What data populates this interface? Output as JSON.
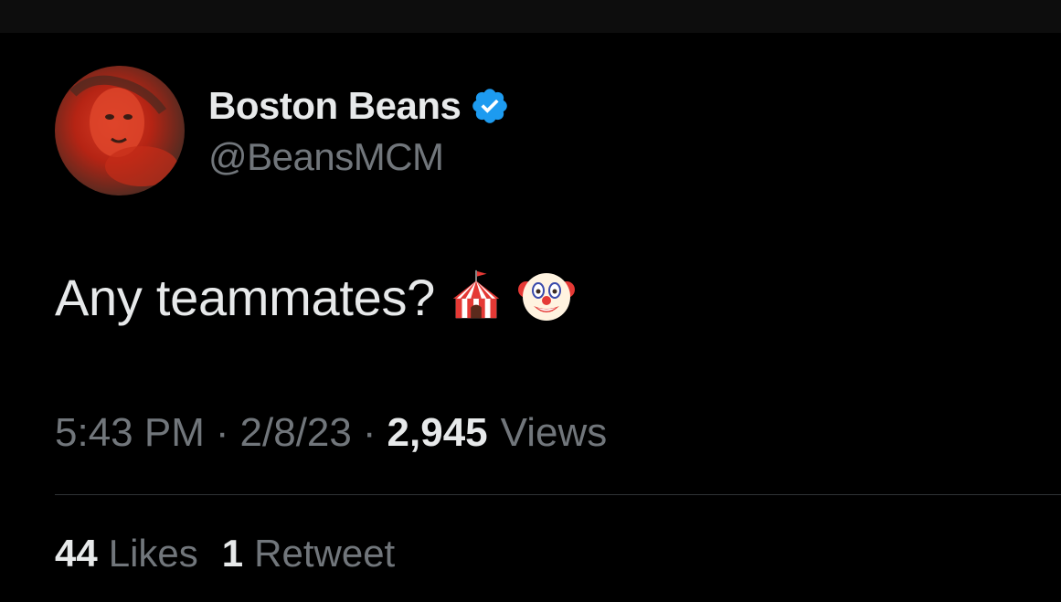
{
  "author": {
    "display_name": "Boston Beans",
    "handle": "@BeansMCM",
    "verified": true,
    "verified_icon": "verified-badge-icon"
  },
  "tweet": {
    "text": "Any teammates?",
    "emojis": [
      "circus-tent-icon",
      "clown-face-icon"
    ]
  },
  "meta": {
    "time": "5:43 PM",
    "separator": "·",
    "date": "2/8/23",
    "views_count": "2,945",
    "views_label": "Views"
  },
  "stats": {
    "likes_count": "44",
    "likes_label": "Likes",
    "retweets_count": "1",
    "retweets_label": "Retweet"
  },
  "colors": {
    "background": "#000000",
    "primary_text": "#e7e9ea",
    "secondary_text": "#71767b",
    "verified_blue": "#1d9bf0",
    "divider": "#2f3336"
  }
}
